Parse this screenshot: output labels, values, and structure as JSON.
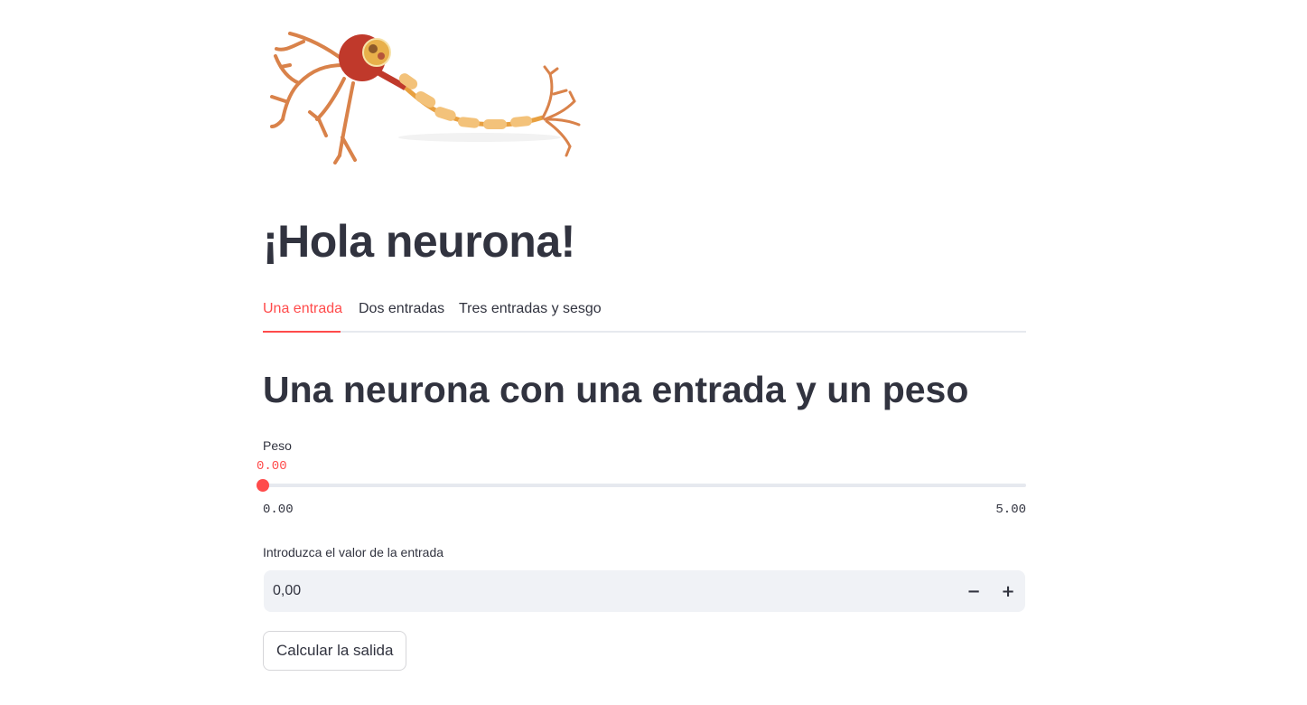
{
  "page": {
    "title": "¡Hola neurona!"
  },
  "hero_image": {
    "icon": "neuron-illustration",
    "colors": {
      "axon": "#e8a040",
      "dendrite": "#d9824a",
      "soma": "#c0392b",
      "myelin": "#f3c27a"
    }
  },
  "tabs": [
    {
      "label": "Una entrada",
      "active": true
    },
    {
      "label": "Dos entradas",
      "active": false
    },
    {
      "label": "Tres entradas y sesgo",
      "active": false
    }
  ],
  "content": {
    "subheader": "Una neurona con una entrada y un peso",
    "slider": {
      "label": "Peso",
      "value": 0.0,
      "value_text": "0.00",
      "min_text": "0.00",
      "max_text": "5.00",
      "min": 0.0,
      "max": 5.0
    },
    "number_input": {
      "label": "Introduzca el valor de la entrada",
      "value": "0,00",
      "minus": "−",
      "plus": "+"
    },
    "button": {
      "label": "Calcular la salida"
    }
  },
  "colors": {
    "accent": "#ff4b4b",
    "text": "#31333f",
    "track": "#e6e9ef",
    "input_bg": "#f0f2f6"
  }
}
